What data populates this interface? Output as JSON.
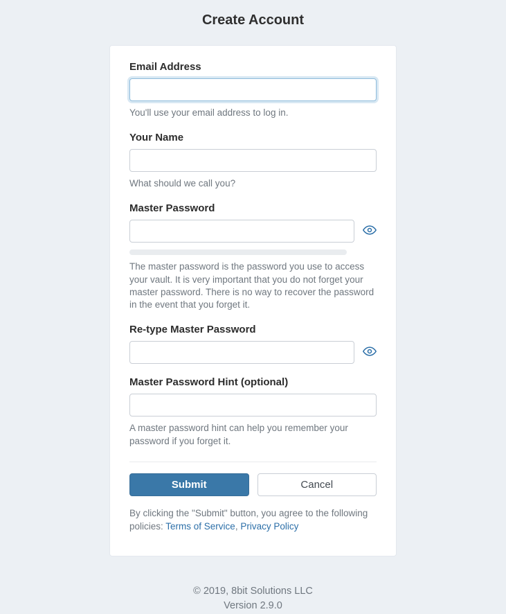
{
  "title": "Create Account",
  "fields": {
    "email": {
      "label": "Email Address",
      "value": "",
      "help": "You'll use your email address to log in."
    },
    "name": {
      "label": "Your Name",
      "value": "",
      "help": "What should we call you?"
    },
    "master_password": {
      "label": "Master Password",
      "value": "",
      "help": "The master password is the password you use to access your vault. It is very important that you do not forget your master password. There is no way to recover the password in the event that you forget it."
    },
    "retype_master_password": {
      "label": "Re-type Master Password",
      "value": ""
    },
    "hint": {
      "label": "Master Password Hint (optional)",
      "value": "",
      "help": "A master password hint can help you remember your password if you forget it."
    }
  },
  "buttons": {
    "submit": "Submit",
    "cancel": "Cancel"
  },
  "policy": {
    "prefix": "By clicking the \"Submit\" button, you agree to the following policies: ",
    "tos": "Terms of Service",
    "separator": ", ",
    "privacy": "Privacy Policy"
  },
  "footer": {
    "copyright": "© 2019, 8bit Solutions LLC",
    "version": "Version 2.9.0"
  }
}
